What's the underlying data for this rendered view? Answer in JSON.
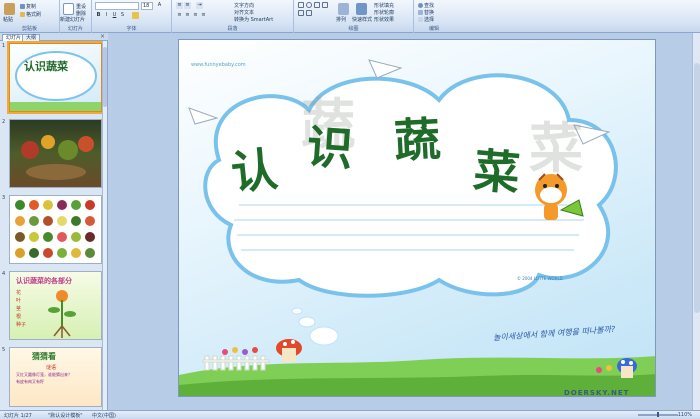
{
  "ribbon": {
    "clipboard": {
      "label": "剪贴板",
      "paste": "粘贴",
      "copy": "复制",
      "format_painter": "格式刷"
    },
    "slides": {
      "label": "幻灯片",
      "new_slide": "新建幻灯片",
      "reset": "重设",
      "delete": "删除"
    },
    "font": {
      "label": "字体",
      "font_name": "",
      "font_size": "18"
    },
    "paragraph": {
      "label": "段落",
      "text_direction": "文字方向",
      "align_text": "对齐文本",
      "convert_smartart": "转换为 SmartArt"
    },
    "drawing": {
      "label": "绘图",
      "arrange": "排列",
      "quick_styles": "快速样式",
      "shape_fill": "形状填充",
      "shape_outline": "形状轮廓",
      "shape_effects": "形状效果"
    },
    "editing": {
      "label": "编辑",
      "find": "查找",
      "replace": "替换",
      "select": "选择"
    }
  },
  "left_panel": {
    "tabs": [
      {
        "label": "幻灯片"
      },
      {
        "label": "大纲"
      }
    ],
    "close": "×",
    "slides": [
      {
        "number": "1",
        "title": "认识蔬菜"
      },
      {
        "number": "2",
        "title": ""
      },
      {
        "number": "3",
        "title": ""
      },
      {
        "number": "4",
        "title": "认识蔬菜的各部分",
        "parts": [
          "花",
          "叶",
          "茎",
          "根",
          "种子"
        ]
      },
      {
        "number": "5",
        "title": "猜猜看",
        "line1": "谜语",
        "line2": "又红又圆像灯笼，谁能猜出来？",
        "line3": "有皮有肉又有籽"
      }
    ]
  },
  "slide": {
    "watermark": "www.funnyebaby.com",
    "title_chars": [
      "认",
      "识",
      "蔬",
      "菜"
    ],
    "ghost_chars": [
      "蔬",
      "菜"
    ],
    "copyright": "© 2004 LOTTE WORLD",
    "korean": "놀이세상에서 함께 여행을 떠나볼까?",
    "brand": "DOERSKY.NET"
  },
  "status": {
    "slide_counter": "幻灯片 1/27",
    "theme": "\"默认设计模板\"",
    "language": "中文(中国)",
    "zoom": "110%"
  },
  "colors": {
    "accent": "#f0a93c",
    "title_green": "#1f6b2a",
    "ribbon_blue": "#c6d7ee"
  }
}
